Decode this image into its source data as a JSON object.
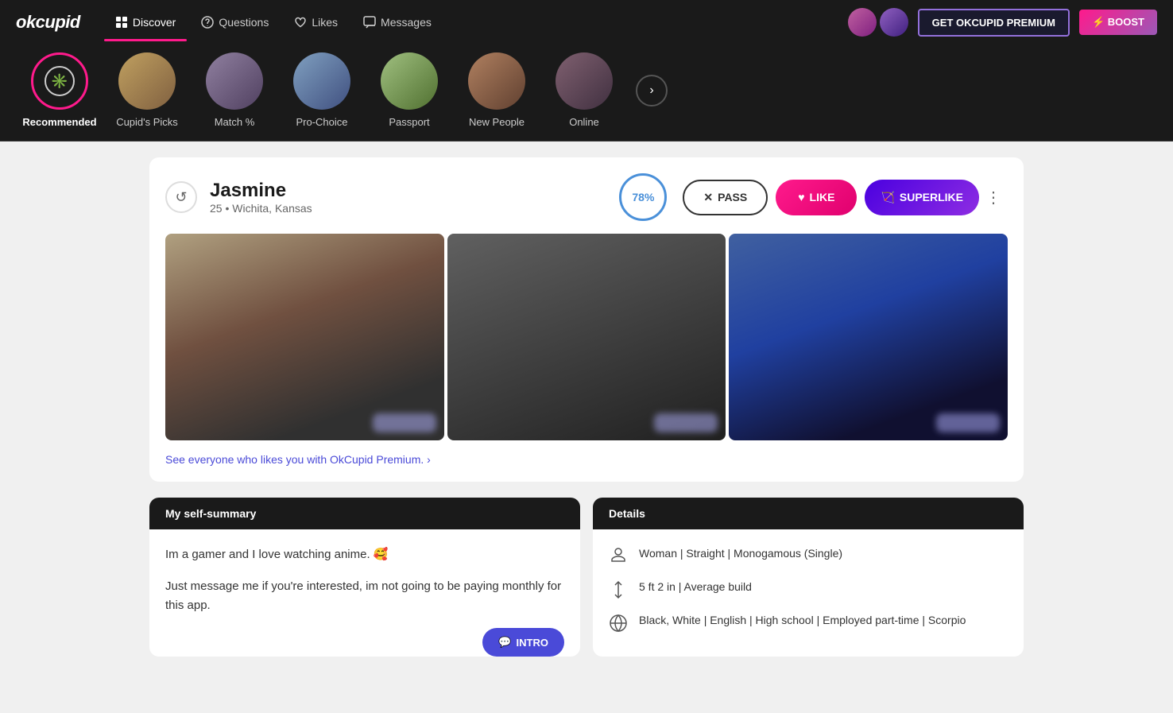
{
  "app": {
    "logo": "okcupid",
    "premium_btn": "GET OKCUPID PREMIUM",
    "boost_btn": "⚡ BOOST"
  },
  "nav": {
    "items": [
      {
        "id": "discover",
        "label": "Discover",
        "active": true,
        "icon": "grid"
      },
      {
        "id": "questions",
        "label": "Questions",
        "active": false,
        "icon": "circle-question"
      },
      {
        "id": "likes",
        "label": "Likes",
        "active": false,
        "icon": "heart"
      },
      {
        "id": "messages",
        "label": "Messages",
        "active": false,
        "icon": "chat"
      }
    ]
  },
  "categories": [
    {
      "id": "recommended",
      "label": "Recommended",
      "active": true,
      "icon_type": "sunburst"
    },
    {
      "id": "cupids-picks",
      "label": "Cupid's Picks",
      "active": false,
      "icon_type": "photo",
      "color": "cat2"
    },
    {
      "id": "match",
      "label": "Match %",
      "active": false,
      "icon_type": "photo",
      "color": "cat3"
    },
    {
      "id": "pro-choice",
      "label": "Pro-Choice",
      "active": false,
      "icon_type": "photo",
      "color": "cat4"
    },
    {
      "id": "passport",
      "label": "Passport",
      "active": false,
      "icon_type": "photo",
      "color": "cat5"
    },
    {
      "id": "new-people",
      "label": "New People",
      "active": false,
      "icon_type": "photo",
      "color": "cat6"
    },
    {
      "id": "online",
      "label": "Online",
      "active": false,
      "icon_type": "photo",
      "color": "cat7"
    }
  ],
  "profile": {
    "name": "Jasmine",
    "age": "25",
    "location": "Wichita, Kansas",
    "match_pct": "78%",
    "pass_label": "PASS",
    "like_label": "LIKE",
    "superlike_label": "SUPERLIKE",
    "summary_header": "My self-summary",
    "summary_text_1": "Im a gamer and I love watching anime. 🥰",
    "summary_text_2": "Just message me if you're interested, im not going to be paying monthly for this app.",
    "intro_label": "INTRO",
    "details_header": "Details",
    "premium_link": "See everyone who likes you with OkCupid Premium. ›",
    "details": [
      {
        "icon": "person",
        "text": "Woman | Straight | Monogamous (Single)"
      },
      {
        "icon": "height",
        "text": "5 ft 2 in | Average build"
      },
      {
        "icon": "globe",
        "text": "Black, White | English | High school | Employed part-time | Scorpio"
      }
    ]
  }
}
